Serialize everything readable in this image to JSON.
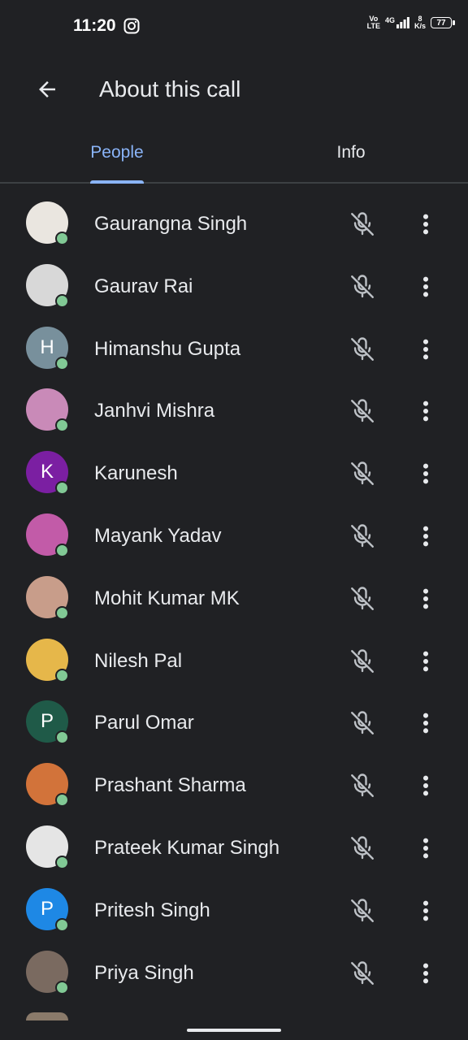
{
  "status": {
    "time": "11:20",
    "net_top": "Vo",
    "net_bottom": "LTE",
    "gen": "4G",
    "speed_top": "8",
    "speed_bottom": "K/s",
    "battery": "77"
  },
  "header": {
    "title": "About this call"
  },
  "tabs": [
    {
      "label": "People"
    },
    {
      "label": "Info"
    }
  ],
  "colors": {
    "background": "#202124",
    "accent": "#8ab4f8",
    "online": "#81c995",
    "icon": "#bdc1c6"
  },
  "participants": [
    {
      "name": "Gaurangna Singh",
      "initial": "",
      "avatar_color": "#eae6e0"
    },
    {
      "name": "Gaurav Rai",
      "initial": "",
      "avatar_color": "#d8d8d8"
    },
    {
      "name": "Himanshu Gupta",
      "initial": "H",
      "avatar_color": "#78909c"
    },
    {
      "name": "Janhvi Mishra",
      "initial": "",
      "avatar_color": "#c98ab8"
    },
    {
      "name": "Karunesh",
      "initial": "K",
      "avatar_color": "#7b1fa2"
    },
    {
      "name": "Mayank Yadav",
      "initial": "",
      "avatar_color": "#c25ba8"
    },
    {
      "name": "Mohit Kumar MK",
      "initial": "",
      "avatar_color": "#c89d8a"
    },
    {
      "name": "Nilesh Pal",
      "initial": "",
      "avatar_color": "#e6b74a"
    },
    {
      "name": "Parul Omar",
      "initial": "P",
      "avatar_color": "#1f5a48"
    },
    {
      "name": "Prashant Sharma",
      "initial": "",
      "avatar_color": "#d2733a"
    },
    {
      "name": "Prateek Kumar Singh",
      "initial": "",
      "avatar_color": "#e5e5e5"
    },
    {
      "name": "Pritesh Singh",
      "initial": "P",
      "avatar_color": "#1e88e5"
    },
    {
      "name": "Priya Singh",
      "initial": "",
      "avatar_color": "#7a6a60"
    }
  ]
}
